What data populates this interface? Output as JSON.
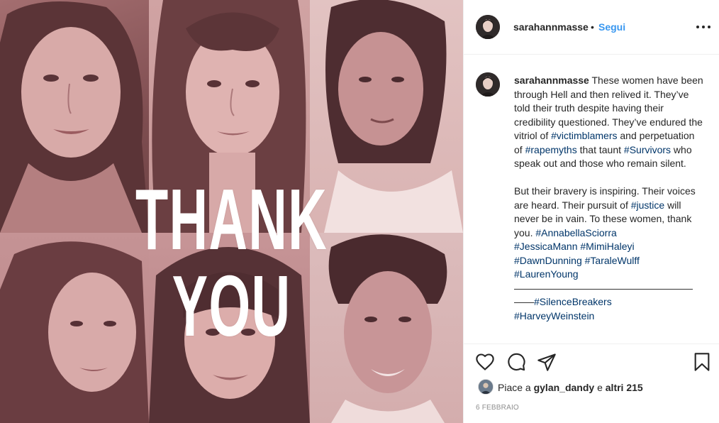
{
  "image": {
    "overlay_text": "THANK YOU",
    "tint_color": "#c89596"
  },
  "header": {
    "username": "sarahannmasse",
    "separator": "•",
    "follow_label": "Segui",
    "more_icon": "more-horizontal-icon"
  },
  "caption": {
    "username": "sarahannmasse",
    "p1": " These women have been through Hell and then relived it. They’ve told their truth despite having their credibility questioned. They’ve endured the vitriol of ",
    "tag1": "#victimblamers",
    "p2": " and perpetuation of ",
    "tag2": "#rapemyths",
    "p3": " that taunt ",
    "tag3": "#Survivors",
    "p4": " who speak out and those who remain silent.\n\nBut their bravery is inspiring. Their voices are heard. Their pursuit of ",
    "tag4": "#justice",
    "p5": " will never be in vain. To these women, thank you. ",
    "tag5": "#AnnabellaSciorra",
    "tag6": "#JessicaMann",
    "tag7": "#MimiHaleyi",
    "tag8": "#DawnDunning",
    "tag9": "#TaraleWulff",
    "tag10": "#LaurenYoung",
    "line": "——————————————————",
    "tag11": "#SilenceBreakers",
    "tag12": "#HarveyWeinstein"
  },
  "actions": {
    "like_icon": "heart-icon",
    "comment_icon": "comment-icon",
    "share_icon": "share-icon",
    "save_icon": "bookmark-icon"
  },
  "likes": {
    "prefix": "Piace a ",
    "user": "gylan_dandy",
    "middle": " e ",
    "others": "altri 215"
  },
  "date": "6 FEBBRAIO"
}
